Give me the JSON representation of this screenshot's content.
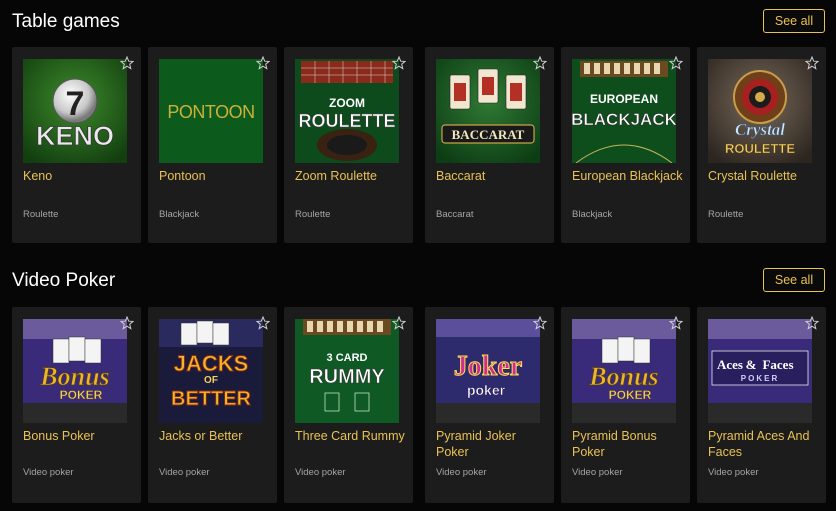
{
  "sections": [
    {
      "title": "Table games",
      "see_all_label": "See all",
      "games": [
        {
          "title": "Keno",
          "category": "Roulette",
          "art_text": [
            "7",
            "KENO"
          ]
        },
        {
          "title": "Pontoon",
          "category": "Blackjack",
          "art_text": [
            "PONTOON"
          ]
        },
        {
          "title": "Zoom Roulette",
          "category": "Roulette",
          "art_text": [
            "ZOOM",
            "ROULETTE"
          ]
        },
        {
          "title": "Baccarat",
          "category": "Baccarat",
          "art_text": [
            "BACCARAT"
          ]
        },
        {
          "title": "European Blackjack",
          "category": "Blackjack",
          "art_text": [
            "EUROPEAN",
            "BLACKJACK"
          ]
        },
        {
          "title": "Crystal Roulette",
          "category": "Roulette",
          "art_text": [
            "Crystal",
            "ROULETTE"
          ]
        }
      ]
    },
    {
      "title": "Video Poker",
      "see_all_label": "See all",
      "games": [
        {
          "title": "Bonus Poker",
          "category": "Video poker",
          "art_text": [
            "Bonus",
            "POKER"
          ]
        },
        {
          "title": "Jacks or Better",
          "category": "Video poker",
          "art_text": [
            "JACKS",
            "OF",
            "BETTER"
          ]
        },
        {
          "title": "Three Card Rummy",
          "category": "Video poker",
          "art_text": [
            "3 CARD",
            "RUMMY"
          ]
        },
        {
          "title": "Pyramid Joker Poker",
          "category": "Video poker",
          "art_text": [
            "Joker",
            "poker"
          ]
        },
        {
          "title": "Pyramid Bonus Poker",
          "category": "Video poker",
          "art_text": [
            "Bonus",
            "POKER"
          ]
        },
        {
          "title": "Pyramid Aces And Faces",
          "category": "Video poker",
          "art_text": [
            "Aces",
            "&",
            "Faces",
            "POKER"
          ]
        }
      ]
    }
  ],
  "colors": {
    "accent": "#e8c253",
    "card_bg": "#1c1c1c",
    "page_bg": "#060606",
    "category_text": "#a5a5a5"
  },
  "icons": {
    "favorite": "star-outline-icon"
  }
}
